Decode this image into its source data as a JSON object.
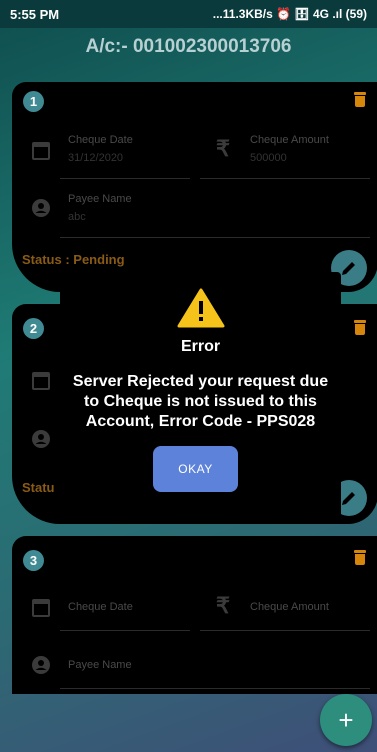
{
  "status_bar": {
    "time": "5:55 PM",
    "right": "...11.3KB/s ⏰ 🗄 4G .ıl (59)"
  },
  "account_title": "A/c:- 001002300013706",
  "cards": [
    {
      "number": "1",
      "cheque_date_label": "Cheque Date",
      "cheque_date": "31/12/2020",
      "cheque_amount_label": "Cheque Amount",
      "cheque_amount": "500000",
      "payee_label": "Payee Name",
      "payee": "abc",
      "status": "Status : Pending"
    },
    {
      "number": "2",
      "status": "Statu"
    },
    {
      "number": "3",
      "cheque_date_label": "Cheque Date",
      "cheque_amount_label": "Cheque Amount",
      "payee_label": "Payee Name"
    }
  ],
  "dialog": {
    "title": "Error",
    "message": "Server Rejected your request due to Cheque is not issued to this Account, Error Code - PPS028",
    "button": "OKAY"
  },
  "fab_label": "+",
  "icons": [
    "calendar-icon",
    "rupee-icon",
    "person-icon",
    "trash-icon",
    "pencil-icon",
    "warning-icon"
  ],
  "colors": {
    "accent": "#d6860b",
    "ok_button": "#5d82d9",
    "fab": "#2d8e7e"
  }
}
